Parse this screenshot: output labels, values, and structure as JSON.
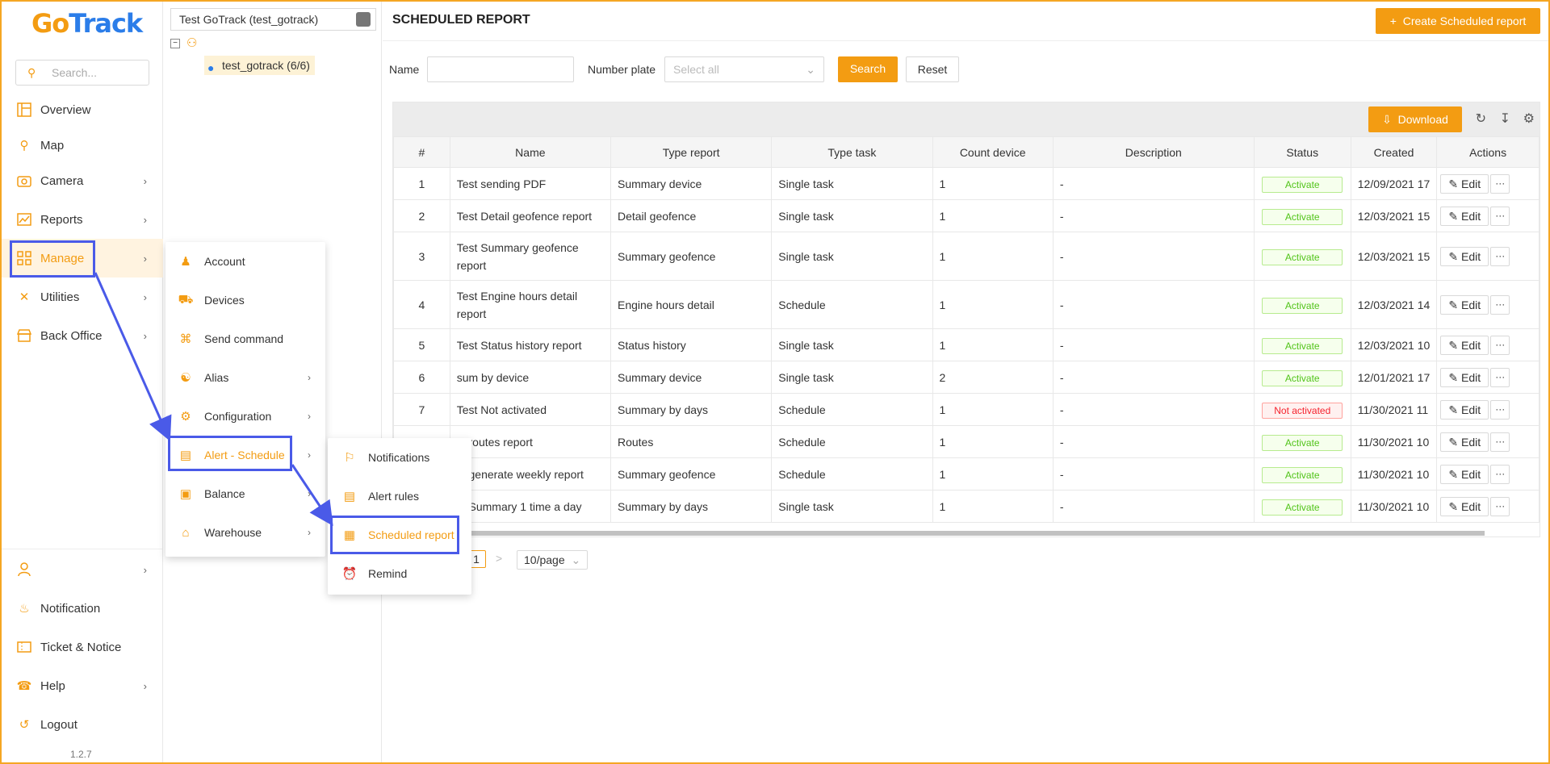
{
  "app": {
    "logo_text_go": "Go",
    "logo_text_track": "Track",
    "version": "1.2.7"
  },
  "sidebar": {
    "search_placeholder": "Search...",
    "items": [
      {
        "label": "Overview",
        "icon": "overview-icon"
      },
      {
        "label": "Map",
        "icon": "map-icon"
      },
      {
        "label": "Camera",
        "icon": "camera-icon"
      },
      {
        "label": "Reports",
        "icon": "reports-icon"
      },
      {
        "label": "Manage",
        "icon": "manage-icon"
      },
      {
        "label": "Utilities",
        "icon": "utilities-icon"
      },
      {
        "label": "Back Office",
        "icon": "back-office-icon"
      }
    ],
    "bottom_items": [
      {
        "label": "",
        "icon": "user-icon"
      },
      {
        "label": "Notification",
        "icon": "bell-icon"
      },
      {
        "label": "Ticket & Notice",
        "icon": "ticket-icon"
      },
      {
        "label": "Help",
        "icon": "headset-icon"
      },
      {
        "label": "Logout",
        "icon": "logout-icon"
      }
    ]
  },
  "tree": {
    "selector": "Test GoTrack (test_gotrack)",
    "node": "test_gotrack (6/6)"
  },
  "manage_menu": {
    "items": [
      {
        "label": "Account"
      },
      {
        "label": "Devices"
      },
      {
        "label": "Send command"
      },
      {
        "label": "Alias"
      },
      {
        "label": "Configuration"
      },
      {
        "label": "Alert - Schedule"
      },
      {
        "label": "Balance"
      },
      {
        "label": "Warehouse"
      }
    ]
  },
  "alert_menu": {
    "items": [
      {
        "label": "Notifications"
      },
      {
        "label": "Alert rules"
      },
      {
        "label": "Scheduled report"
      },
      {
        "label": "Remind"
      }
    ]
  },
  "main": {
    "title": "SCHEDULED REPORT",
    "create_button": "Create Scheduled report",
    "filters": {
      "name_label": "Name",
      "plate_label": "Number plate",
      "plate_placeholder": "Select all",
      "search_button": "Search",
      "reset_button": "Reset"
    },
    "download_button": "Download",
    "columns": [
      "#",
      "Name",
      "Type report",
      "Type task",
      "Count device",
      "Description",
      "Status",
      "Created",
      "Actions"
    ],
    "rows": [
      [
        "1",
        "Test sending PDF",
        "Summary device",
        "Single task",
        "1",
        "-",
        "Activate",
        "12/09/2021 17"
      ],
      [
        "2",
        "Test Detail geofence report",
        "Detail geofence",
        "Single task",
        "1",
        "-",
        "Activate",
        "12/03/2021 15"
      ],
      [
        "3",
        "Test Summary geofence report",
        "Summary geofence",
        "Single task",
        "1",
        "-",
        "Activate",
        "12/03/2021 15"
      ],
      [
        "4",
        "Test Engine hours detail report",
        "Engine hours detail",
        "Schedule",
        "1",
        "-",
        "Activate",
        "12/03/2021 14"
      ],
      [
        "5",
        "Test Status history report",
        "Status history",
        "Single task",
        "1",
        "-",
        "Activate",
        "12/03/2021 10"
      ],
      [
        "6",
        "sum by device",
        "Summary device",
        "Single task",
        "2",
        "-",
        "Activate",
        "12/01/2021 17"
      ],
      [
        "7",
        "Test Not activated",
        "Summary by days",
        "Schedule",
        "1",
        "-",
        "Not activated",
        "11/30/2021 11"
      ],
      [
        "",
        "st routes report",
        "Routes",
        "Schedule",
        "1",
        "-",
        "Activate",
        "11/30/2021 10"
      ],
      [
        "",
        "st generate weekly report",
        "Summary geofence",
        "Schedule",
        "1",
        "-",
        "Activate",
        "11/30/2021 10"
      ],
      [
        "",
        "st Summary 1 time a day",
        "Summary by days",
        "Single task",
        "1",
        "-",
        "Activate",
        "11/30/2021 10"
      ]
    ],
    "edit_label": "Edit",
    "more_label": "···",
    "pagination": {
      "page": "1",
      "next": ">",
      "page_size": "10/page"
    }
  },
  "colors": {
    "accent": "#f39c12",
    "highlight": "#4a5ae8",
    "brand_blue": "#2b7de9"
  }
}
